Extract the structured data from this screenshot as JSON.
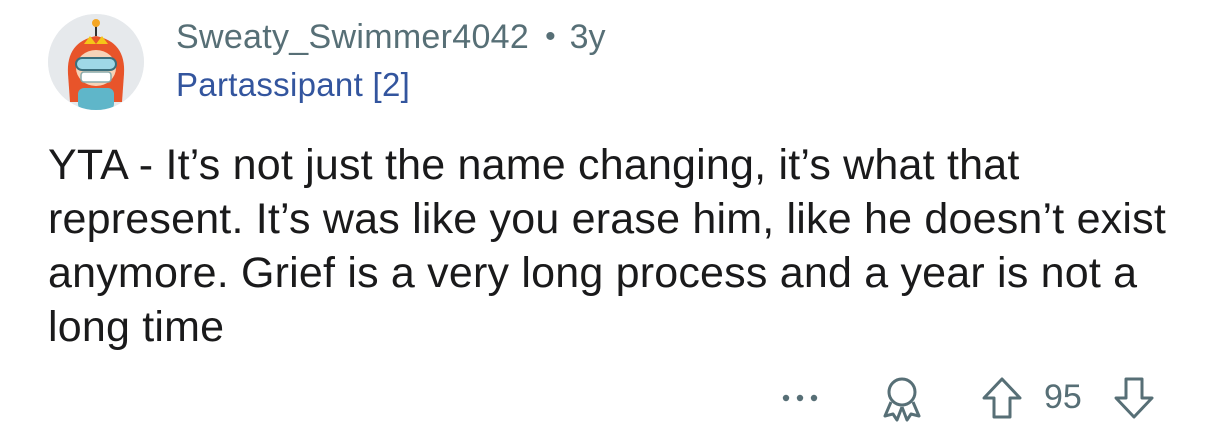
{
  "comment": {
    "author": "Sweaty_Swimmer4042",
    "separator": "•",
    "age": "3y",
    "flair": "Partassipant [2]",
    "body": "YTA - It’s not just the name changing, it’s what that represent. It’s was like you erase him, like he doesn’t exist anymore. Grief is a very long process and a year is not a long time",
    "score": "95"
  },
  "icons": {
    "more": "more-horizontal-icon",
    "award": "award-icon",
    "upvote": "upvote-arrow-icon",
    "downvote": "downvote-arrow-icon"
  },
  "colors": {
    "meta_text": "#576f76",
    "flair_text": "#33559e",
    "body_text": "#1a1a1b"
  }
}
